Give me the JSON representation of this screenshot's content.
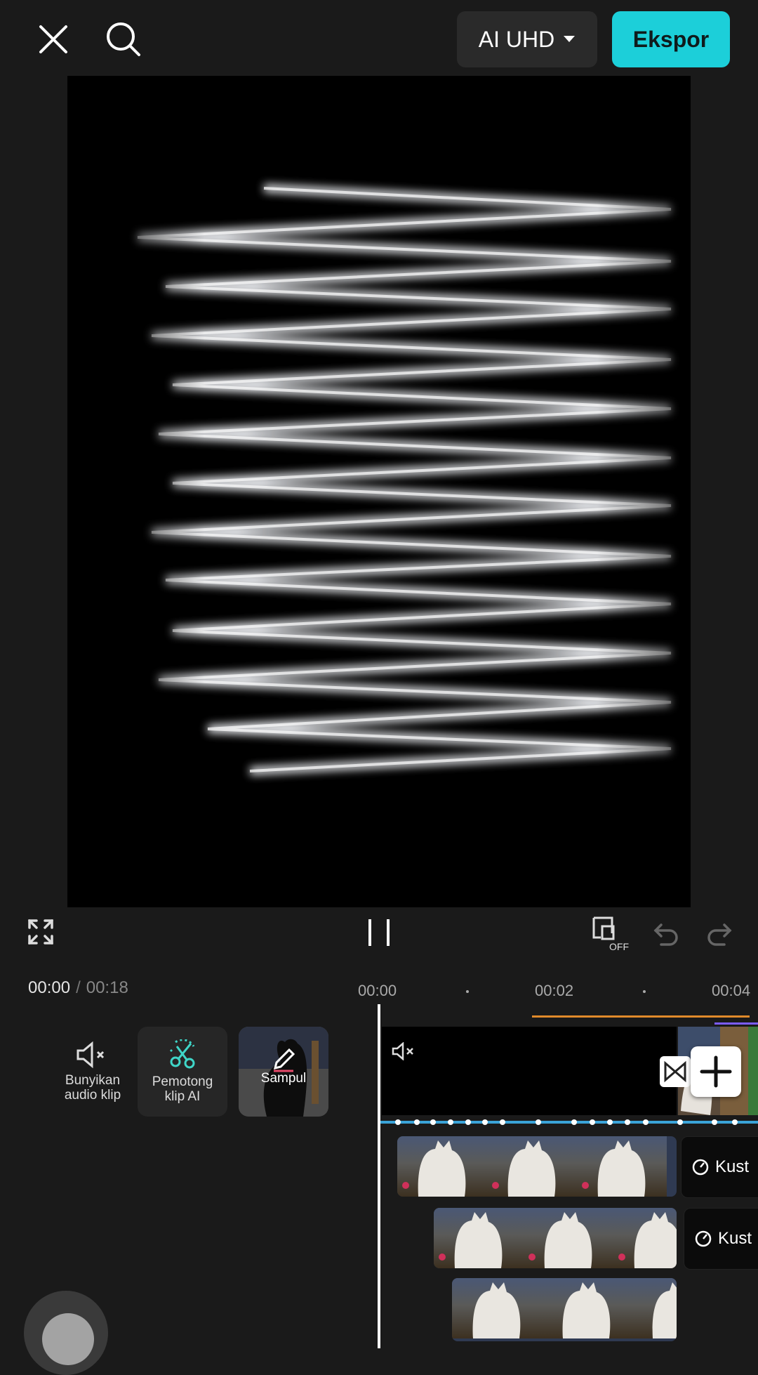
{
  "top_bar": {
    "close_icon": "close-icon",
    "search_icon": "search-icon",
    "quality_label": "AI UHD",
    "export_label": "Ekspor"
  },
  "playback": {
    "current_time": "00:00",
    "separator": "/",
    "total_time": "00:18",
    "state_icon": "pause-icon"
  },
  "ruler": {
    "labels": [
      "00:00",
      "00:02",
      "00:04"
    ]
  },
  "tools": [
    {
      "icon": "mute-audio-icon",
      "label_line1": "Bunyikan",
      "label_line2": "audio klip"
    },
    {
      "icon": "ai-scissors-icon",
      "label_line1": "Pemotong",
      "label_line2": "klip AI"
    },
    {
      "icon": "pencil-icon",
      "label": "Sampul"
    }
  ],
  "timeline": {
    "overlay_chips": [
      {
        "label": "Kust"
      },
      {
        "label": "Kust"
      }
    ]
  },
  "colors": {
    "accent": "#1ccfd9",
    "background": "#1a1a1a",
    "audio_track": "#3aa3d8"
  }
}
